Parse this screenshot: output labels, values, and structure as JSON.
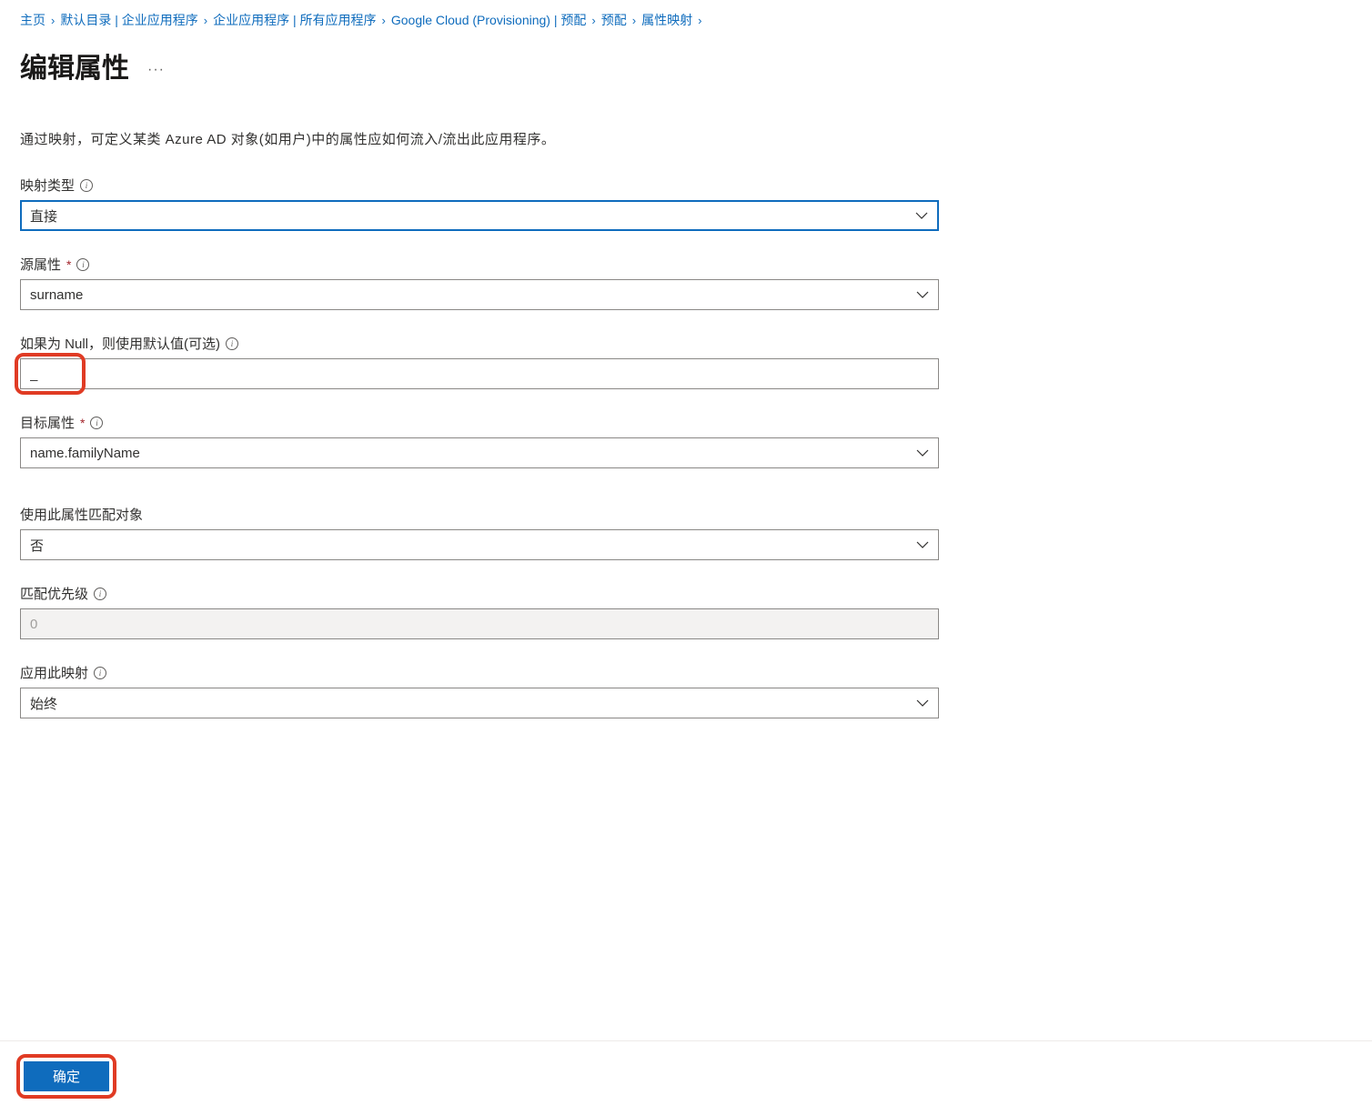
{
  "breadcrumb": {
    "items": [
      {
        "label": "主页"
      },
      {
        "label": "默认目录 | 企业应用程序"
      },
      {
        "label": "企业应用程序 | 所有应用程序"
      },
      {
        "label": "Google Cloud (Provisioning) | 预配"
      },
      {
        "label": "预配"
      },
      {
        "label": "属性映射"
      }
    ]
  },
  "page": {
    "title": "编辑属性",
    "more": "···",
    "description": "通过映射，可定义某类 Azure AD 对象(如用户)中的属性应如何流入/流出此应用程序。"
  },
  "form": {
    "mapping_type": {
      "label": "映射类型",
      "value": "直接"
    },
    "source_attribute": {
      "label": "源属性",
      "value": "surname"
    },
    "default_if_null": {
      "label": "如果为 Null，则使用默认值(可选)",
      "value": "_"
    },
    "target_attribute": {
      "label": "目标属性",
      "value": "name.familyName"
    },
    "match_objects": {
      "label": "使用此属性匹配对象",
      "value": "否"
    },
    "matching_precedence": {
      "label": "匹配优先级",
      "value": "0"
    },
    "apply_mapping": {
      "label": "应用此映射",
      "value": "始终"
    }
  },
  "buttons": {
    "ok": "确定"
  }
}
